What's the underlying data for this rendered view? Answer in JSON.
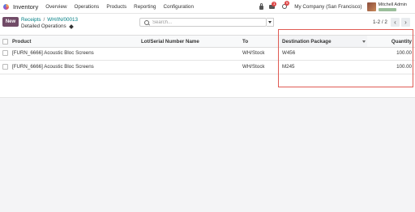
{
  "navbar": {
    "app_name": "Inventory",
    "menu": [
      "Overview",
      "Operations",
      "Products",
      "Reporting",
      "Configuration"
    ],
    "chat_badge": "1",
    "activity_badge": "5",
    "company": "My Company (San Francisco)",
    "user_name": "Mitchell Admin"
  },
  "control": {
    "new_label": "New",
    "breadcrumb": {
      "parent": "Receipts",
      "separator": "/",
      "current": "WH/IN/00013"
    },
    "subtitle": "Detailed Operations",
    "search_placeholder": "Search...",
    "pager": "1-2 / 2"
  },
  "table": {
    "columns": {
      "product": "Product",
      "lot": "Lot/Serial Number Name",
      "to": "To",
      "destination_package": "Destination Package",
      "quantity": "Quantity"
    },
    "rows": [
      {
        "product": "[FURN_6666] Acoustic Bloc Screens",
        "lot": "",
        "to": "WH/Stock",
        "destination_package": "W456",
        "quantity": "100.00"
      },
      {
        "product": "[FURN_6666] Acoustic Bloc Screens",
        "lot": "",
        "to": "WH/Stock",
        "destination_package": "M245",
        "quantity": "100.00"
      }
    ]
  }
}
